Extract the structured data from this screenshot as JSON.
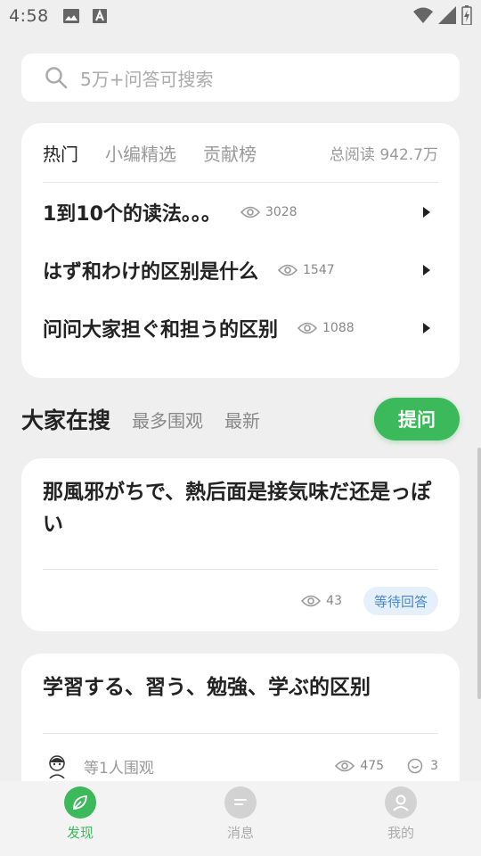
{
  "status_bar": {
    "time": "4:58"
  },
  "search": {
    "placeholder": "5万+问答可搜索"
  },
  "hot": {
    "tabs": [
      "热门",
      "小编精选",
      "贡献榜"
    ],
    "total_reads": "总阅读 942.7万",
    "items": [
      {
        "title": "1到10个的读法。。。",
        "views": "3028"
      },
      {
        "title": "はず和わけ的区别是什么",
        "views": "1547"
      },
      {
        "title": "问问大家担ぐ和担う的区别",
        "views": "1088"
      }
    ]
  },
  "section": {
    "title": "大家在搜",
    "tabs": [
      "最多围观",
      "最新"
    ],
    "ask_button": "提问"
  },
  "questions": [
    {
      "title": "那風邪がちで、熱后面是接気味だ还是っぽい",
      "views": "43",
      "status": "等待回答"
    },
    {
      "title": "学習する、習う、勉強、学ぶ的区别",
      "watchers": "等1人围观",
      "views": "475",
      "answers": "3"
    }
  ],
  "tab_bar": {
    "items": [
      "发现",
      "消息",
      "我的"
    ]
  },
  "colors": {
    "accent": "#3cb95a",
    "badge_bg": "#e6f0fb",
    "badge_text": "#4a86c8"
  }
}
